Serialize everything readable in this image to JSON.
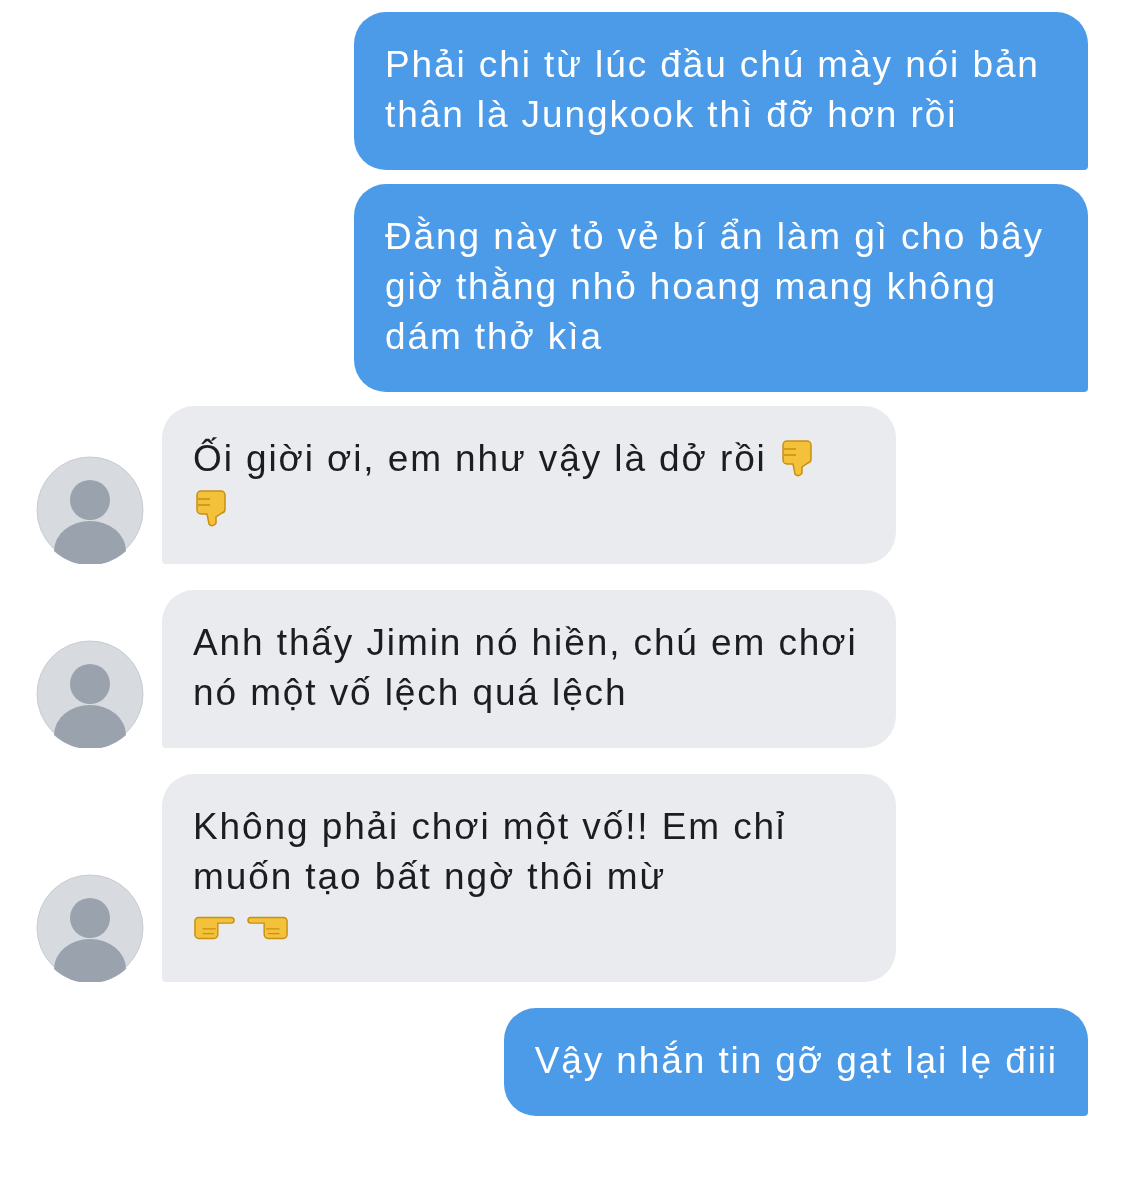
{
  "messages": [
    {
      "kind": "outgoing",
      "text": "Phải chi từ lúc đầu chú mày nói bản thân là Jungkook thì đỡ hơn rồi"
    },
    {
      "kind": "outgoing",
      "text": "Đằng này tỏ vẻ bí ẩn làm gì cho bây giờ thằng nhỏ hoang mang không dám thở kìa"
    },
    {
      "kind": "incoming",
      "text": "Ối giời ơi, em như vậy là dở rồi",
      "icons": [
        {
          "kind": "thumbs-down"
        },
        {
          "kind": "thumbs-down"
        }
      ]
    },
    {
      "kind": "incoming",
      "text": "Anh thấy Jimin nó hiền, chú em chơi nó một vố lệch quá lệch"
    },
    {
      "kind": "incoming",
      "text": "Không phải chơi một vố!! Em chỉ muốn tạo bất ngờ thôi mừ",
      "icons": [
        {
          "kind": "point-right"
        },
        {
          "kind": "point-left"
        }
      ]
    },
    {
      "kind": "outgoing",
      "text": "Vậy nhắn tin gỡ gạt lại lẹ điii"
    }
  ]
}
